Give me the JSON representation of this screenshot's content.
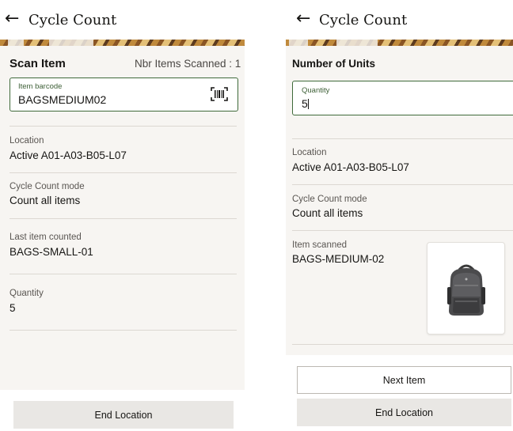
{
  "left": {
    "header": {
      "title": "Cycle Count",
      "back_icon": "arrow-left-icon"
    },
    "scan": {
      "title": "Scan Item",
      "count_label": "Nbr Items Scanned : 1",
      "field_label": "Item barcode",
      "field_value": "BAGSMEDIUM02",
      "icon": "barcode-scan-icon"
    },
    "location": {
      "label": "Location",
      "value": "Active A01-A03-B05-L07"
    },
    "mode": {
      "label": "Cycle Count mode",
      "value": "Count all items"
    },
    "last_item": {
      "label": "Last item counted",
      "value": "BAGS-SMALL-01"
    },
    "quantity": {
      "label": "Quantity",
      "value": "5"
    },
    "end_location_button": "End Location"
  },
  "right": {
    "header": {
      "title": "Cycle Count",
      "back_icon": "arrow-left-icon"
    },
    "units": {
      "title": "Number of Units",
      "field_label": "Quantity",
      "field_value": "5"
    },
    "location": {
      "label": "Location",
      "value": "Active A01-A03-B05-L07"
    },
    "mode": {
      "label": "Cycle Count mode",
      "value": "Count all items"
    },
    "item_scanned": {
      "label": "Item scanned",
      "value": "BAGS-MEDIUM-02",
      "image_icon": "backpack-image"
    },
    "next_item_button": "Next Item",
    "end_location_button": "End Location"
  },
  "colors": {
    "field_border": "#3f6a3a",
    "background": "#f7f5f2",
    "button_gray": "#e9e7e4"
  }
}
